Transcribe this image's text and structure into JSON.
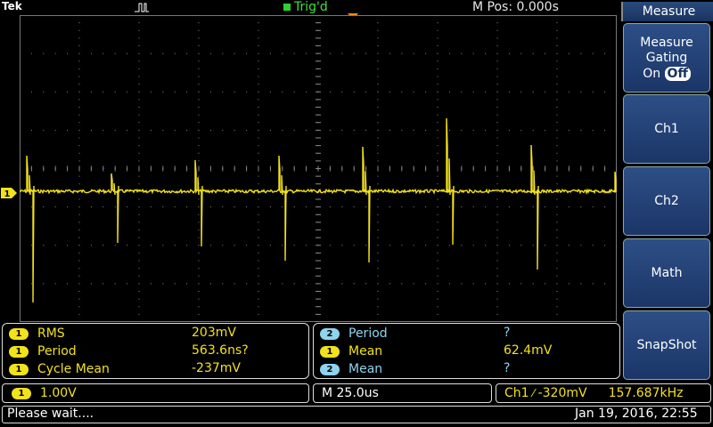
{
  "top": {
    "brand": "Tek",
    "trigger_status": "Trig'd",
    "m_pos": "M Pos: 0.000s"
  },
  "colors": {
    "ch1": "#f2e21c",
    "ch2": "#8fd4ee",
    "menu": "#1b3567",
    "trig": "#3ee03e",
    "marker": "#f08a1c"
  },
  "markers": {
    "ch1_level": "1",
    "trigger_pos": "T"
  },
  "menu": {
    "title": "Measure",
    "buttons": [
      {
        "label": "Measure Gating",
        "sub_on": "On",
        "sub_off": "Off"
      },
      {
        "label": "Ch1"
      },
      {
        "label": "Ch2"
      },
      {
        "label": "Math"
      },
      {
        "label": "SnapShot"
      }
    ]
  },
  "measurements_left": [
    {
      "ch": "1",
      "name": "RMS",
      "value": "203mV"
    },
    {
      "ch": "1",
      "name": "Period",
      "value": "563.6ns?"
    },
    {
      "ch": "1",
      "name": "Cycle Mean",
      "value": "-237mV"
    }
  ],
  "measurements_right": [
    {
      "ch": "2",
      "name": "Period",
      "value": "?"
    },
    {
      "ch": "1",
      "name": "Mean",
      "value": "62.4mV"
    },
    {
      "ch": "2",
      "name": "Mean",
      "value": "?"
    }
  ],
  "status": {
    "ch1_badge": "1",
    "ch1_scale": "1.00V",
    "timebase": "M 25.0us",
    "trigger_src": "Ch1",
    "trigger_slope": "⁄",
    "trigger_level": "-320mV",
    "trigger_freq": "157.687kHz"
  },
  "footer": {
    "message": "Please wait....",
    "datetime": "Jan 19, 2016, 22:55"
  }
}
